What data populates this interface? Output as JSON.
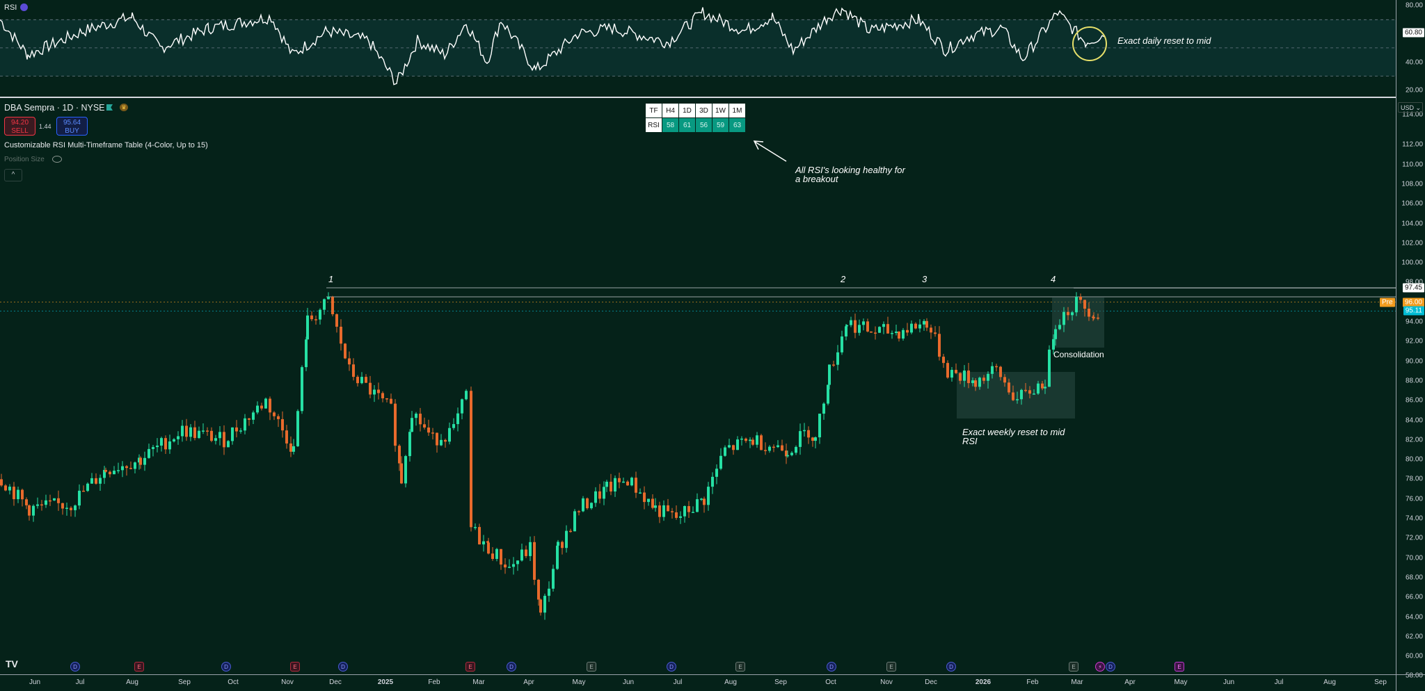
{
  "chart": {
    "symbol_title": "DBA Sempra · 1D · NYSE",
    "sell": {
      "price": "94.20",
      "label": "SELL"
    },
    "buy": {
      "price": "95.64",
      "label": "BUY"
    },
    "spread": "1.44",
    "indicator_name": "Customizable RSI Multi-Timeframe Table (4-Color, Up to 15)",
    "position_size_label": "Position Size",
    "collapse_icon": "^",
    "currency": "USD",
    "logo": "TV"
  },
  "rsi_pane": {
    "title": "RSI",
    "current_value": "60.80",
    "axis_ticks": [
      "80.00",
      "60.00",
      "40.00",
      "20.00"
    ]
  },
  "rsi_table": {
    "headers": [
      "TF",
      "H4",
      "1D",
      "3D",
      "1W",
      "1M"
    ],
    "row_label": "RSI",
    "values": [
      "58",
      "61",
      "56",
      "59",
      "63"
    ]
  },
  "price_axis": {
    "ticks": [
      "112.00",
      "110.00",
      "108.00",
      "106.00",
      "104.00",
      "102.00",
      "100.00",
      "98.00",
      "94.00",
      "92.00",
      "90.00",
      "88.00",
      "86.00",
      "84.00",
      "82.00",
      "80.00",
      "78.00",
      "76.00",
      "74.00",
      "72.00",
      "70.00",
      "68.00",
      "66.00",
      "64.00",
      "62.00",
      "60.00",
      "58.00"
    ],
    "partial_top": "114.00",
    "badge_high": "97.45",
    "badge_pre_tag": "Pre",
    "badge_pre": "96.00",
    "badge_last": "95.11"
  },
  "time_axis": {
    "labels": [
      "Jun",
      "Jul",
      "Aug",
      "Sep",
      "Oct",
      "Nov",
      "Dec",
      "2025",
      "Feb",
      "Mar",
      "Apr",
      "May",
      "Jun",
      "Jul",
      "Aug",
      "Sep",
      "Oct",
      "Nov",
      "Dec",
      "2026",
      "Feb",
      "Mar",
      "Apr",
      "May",
      "Jun",
      "Jul",
      "Aug",
      "Sep"
    ]
  },
  "annotations": {
    "rsi_daily": "Exact daily reset to mid",
    "rsi_healthy_line1": "All RSI's looking healthy for",
    "rsi_healthy_line2": "a breakout",
    "weekly_line1": "Exact weekly reset to mid",
    "weekly_line2": "RSI",
    "consolidation": "Consolidation",
    "touch_labels": [
      "1",
      "2",
      "3",
      "4"
    ]
  },
  "events": {
    "dividend": "D",
    "earnings": "E",
    "split": "⚡"
  },
  "colors": {
    "background": "#052219",
    "up": "#26e0a4",
    "down": "#e86a2c",
    "rsi_line": "#ffffff",
    "last_price": "#00bcd4",
    "pre_market": "#f39c1f",
    "table_value": "#089981"
  }
}
